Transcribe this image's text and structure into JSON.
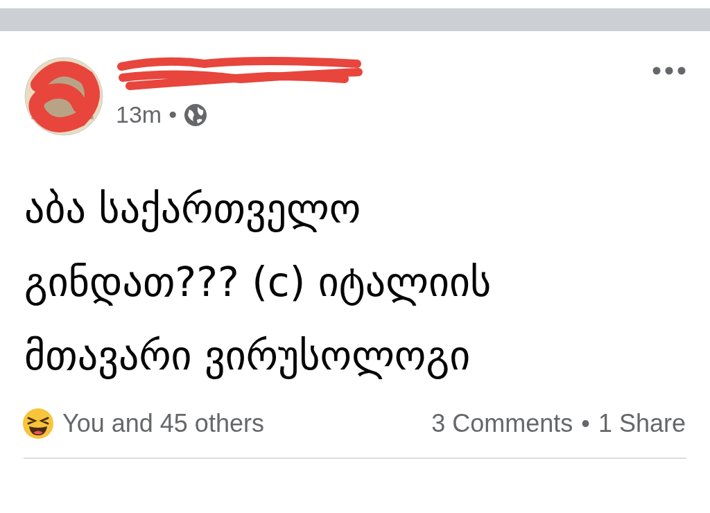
{
  "post": {
    "time": "13m",
    "separator": "•",
    "public": true,
    "body": "აბა საქართველო\nგინდათ??? (c) იტალიის\nმთავარი ვირუსოლოგი"
  },
  "footer": {
    "reactions": "You and 45 others",
    "comments": "3 Comments",
    "separator": "•",
    "shares": "1 Share"
  }
}
